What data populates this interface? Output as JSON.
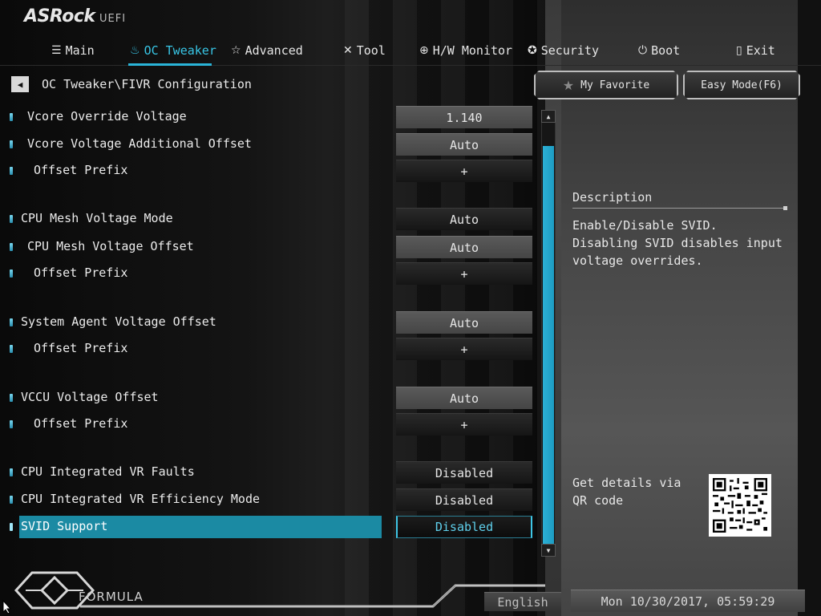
{
  "header": {
    "brand": "ASRock",
    "brand_suffix": "UEFI"
  },
  "nav": {
    "tabs": [
      {
        "label": "Main",
        "icon": "list-icon"
      },
      {
        "label": "OC Tweaker",
        "icon": "flame-icon"
      },
      {
        "label": "Advanced",
        "icon": "star-icon"
      },
      {
        "label": "Tool",
        "icon": "tools-icon"
      },
      {
        "label": "H/W Monitor",
        "icon": "monitor-icon"
      },
      {
        "label": "Security",
        "icon": "shield-icon"
      },
      {
        "label": "Boot",
        "icon": "power-icon"
      },
      {
        "label": "Exit",
        "icon": "exit-icon"
      }
    ],
    "active_tab": "OC Tweaker"
  },
  "breadcrumb": "OC Tweaker\\FIVR Configuration",
  "buttons": {
    "favorite": "My Favorite",
    "easy_mode": "Easy Mode(F6)"
  },
  "settings": [
    {
      "label": "Vcore Override Voltage",
      "value": "1.140"
    },
    {
      "label": "Vcore Voltage Additional Offset",
      "value": "Auto"
    },
    {
      "label": "Offset Prefix",
      "value": "+"
    },
    {
      "label": "CPU Mesh Voltage Mode",
      "value": "Auto"
    },
    {
      "label": "CPU Mesh Voltage Offset",
      "value": "Auto"
    },
    {
      "label": "Offset Prefix",
      "value": "+"
    },
    {
      "label": "System Agent Voltage Offset",
      "value": "Auto"
    },
    {
      "label": "Offset Prefix",
      "value": "+"
    },
    {
      "label": "VCCU Voltage Offset",
      "value": "Auto"
    },
    {
      "label": "Offset Prefix",
      "value": "+"
    },
    {
      "label": "CPU Integrated VR Faults",
      "value": "Disabled"
    },
    {
      "label": "CPU Integrated VR Efficiency Mode",
      "value": "Disabled"
    },
    {
      "label": "SVID Support",
      "value": "Disabled"
    }
  ],
  "selected_setting": "SVID Support",
  "description": {
    "title": "Description",
    "text": "Enable/Disable SVID. Disabling SVID disables input voltage overrides.",
    "qr_caption": "Get details via QR code"
  },
  "footer": {
    "logo_text": "FORMULA",
    "language": "English",
    "datetime": "Mon 10/30/2017, 05:59:29"
  },
  "colors": {
    "accent": "#2ab4d8",
    "selected_row": "#1b8aa3"
  }
}
